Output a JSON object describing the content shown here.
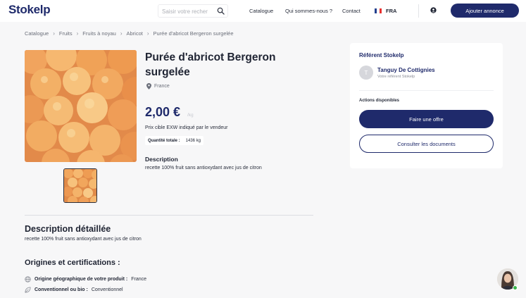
{
  "header": {
    "logo": "Stokelp",
    "search_placeholder": "Saisir votre recher",
    "nav": [
      "Catalogue",
      "Qui sommes-nous ?",
      "Contact"
    ],
    "language": "FRA",
    "cta": "Ajouter annonce"
  },
  "breadcrumb": [
    "Catalogue",
    "Fruits",
    "Fruits à noyau",
    "Abricot",
    "Purée d'abricot Bergeron surgelée"
  ],
  "product": {
    "title": "Purée d'abricot Bergeron surgelée",
    "location": "France",
    "price": "2,00 €",
    "price_unit": "/kg",
    "price_note": "Prix cible EXW indiqué par le vendeur",
    "quantity_label": "Quantité totale :",
    "quantity_value": "1436 kg",
    "description_heading": "Description",
    "description_text": "recette 100% fruit sans antioxydant avec jus de citron"
  },
  "referent": {
    "title": "Référent Stokelp",
    "avatar_letter": "T",
    "name": "Tanguy De Cottignies",
    "subtitle": "Votre référent Stokelp",
    "actions_label": "Actions disponibles",
    "offer_button": "Faire une offre",
    "documents_button": "Consulter les documents"
  },
  "details": {
    "heading": "Description détaillée",
    "text": "recette 100% fruit sans antioxydant avec jus de citron",
    "origins_heading": "Origines et certifications :",
    "origin_label": "Origine géographique de votre produit :",
    "origin_value": "France",
    "organic_label": "Conventionnel ou bio :",
    "organic_value": "Conventionnel"
  },
  "colors": {
    "brand": "#1f2a6b",
    "online": "#3ab54a"
  },
  "icons": {
    "search": "search-icon",
    "flag": "france-flag-icon",
    "user": "user-icon",
    "location": "location-pin-icon",
    "globe": "globe-icon",
    "leaf": "leaf-icon",
    "chevron": "chevron-right-icon"
  }
}
